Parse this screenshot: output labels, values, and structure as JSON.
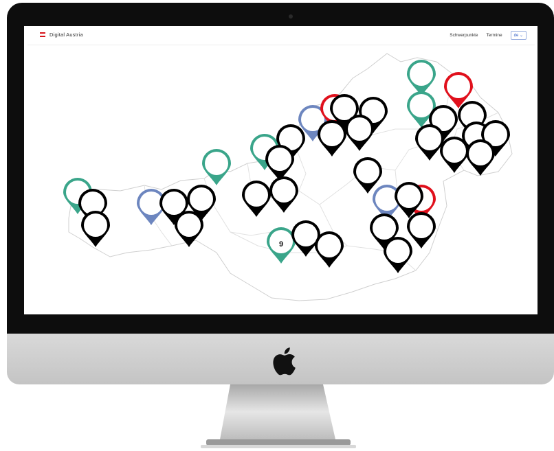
{
  "navbar": {
    "brand": "Digital Austria",
    "links": [
      "Schwerpunkte",
      "Termine"
    ],
    "language": "de ⌄"
  },
  "map": {
    "cluster_count_label": "9"
  },
  "colors": {
    "green": "#3aa58a",
    "blue": "#6d86bf",
    "red": "#e0101c",
    "black": "#000000",
    "border": "#cfcfcf"
  }
}
